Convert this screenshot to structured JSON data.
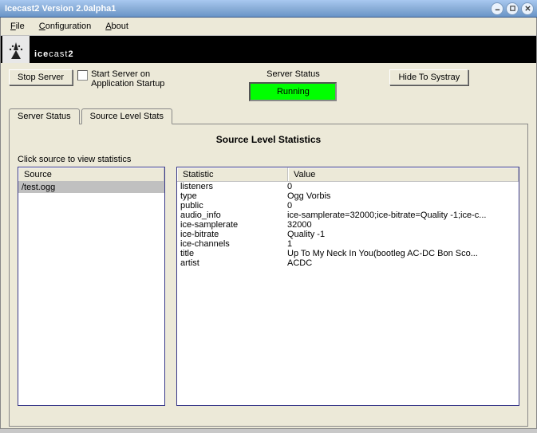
{
  "title": "Icecast2 Version 2.0alpha1",
  "menu": {
    "file": "File",
    "configuration": "Configuration",
    "about": "About"
  },
  "logo": {
    "brand": "ice",
    "brand2": "cast",
    "brand3": "2"
  },
  "buttons": {
    "stop_server": "Stop Server",
    "hide_systray": "Hide To Systray"
  },
  "checkbox": {
    "label_line1": "Start Server on",
    "label_line2": "Application Startup"
  },
  "status": {
    "label": "Server Status",
    "value": "Running"
  },
  "tabs": {
    "server_status": "Server Status",
    "source_level_stats": "Source Level Stats"
  },
  "panel": {
    "title": "Source Level Statistics",
    "hint": "Click source to view statistics",
    "source_header": "Source",
    "stat_header": "Statistic",
    "value_header": "Value"
  },
  "sources": [
    {
      "name": "/test.ogg"
    }
  ],
  "stats": [
    {
      "name": "listeners",
      "value": "0"
    },
    {
      "name": "type",
      "value": "Ogg Vorbis"
    },
    {
      "name": "public",
      "value": "0"
    },
    {
      "name": "audio_info",
      "value": "ice-samplerate=32000;ice-bitrate=Quality -1;ice-c..."
    },
    {
      "name": "ice-samplerate",
      "value": "32000"
    },
    {
      "name": "ice-bitrate",
      "value": "Quality -1"
    },
    {
      "name": "ice-channels",
      "value": "1"
    },
    {
      "name": "title",
      "value": "Up To My Neck In You(bootleg AC-DC Bon Sco..."
    },
    {
      "name": "artist",
      "value": "ACDC"
    }
  ]
}
